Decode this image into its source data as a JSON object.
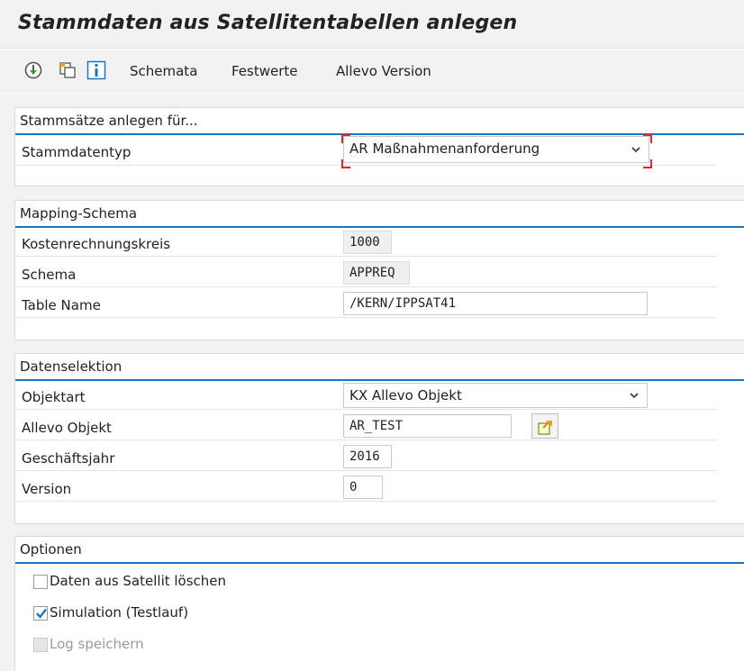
{
  "window": {
    "title": "Stammdaten aus Satellitentabellen anlegen"
  },
  "toolbar": {
    "icons": [
      "execute-icon",
      "copy-icon",
      "info-icon"
    ],
    "menu": [
      "Schemata",
      "Festwerte",
      "Allevo Version"
    ]
  },
  "section1": {
    "title": "Stammsätze anlegen für...",
    "stammdatentyp_label": "Stammdatentyp",
    "stammdatentyp_value": "AR Maßnahmenanforderung"
  },
  "section2": {
    "title": "Mapping-Schema",
    "kostenrechnungskreis_label": "Kostenrechnungskreis",
    "kostenrechnungskreis_value": "1000",
    "schema_label": "Schema",
    "schema_value": "APPREQ",
    "table_name_label": "Table Name",
    "table_name_value": "/KERN/IPPSAT41"
  },
  "section3": {
    "title": "Datenselektion",
    "objektart_label": "Objektart",
    "objektart_value": "KX Allevo Objekt",
    "allevo_objekt_label": "Allevo Objekt",
    "allevo_objekt_value": "AR_TEST",
    "geschaeftsjahr_label": "Geschäftsjahr",
    "geschaeftsjahr_value": "2016",
    "version_label": "Version",
    "version_value": "0"
  },
  "section4": {
    "title": "Optionen",
    "options": [
      {
        "label": "Daten aus Satellit löschen",
        "checked": false,
        "disabled": false
      },
      {
        "label": "Simulation (Testlauf)",
        "checked": true,
        "disabled": false
      },
      {
        "label": "Log speichern",
        "checked": false,
        "disabled": true
      }
    ]
  },
  "colors": {
    "accent": "#1d75c0",
    "required": "#e0262b",
    "band": "#f2f2f2"
  }
}
